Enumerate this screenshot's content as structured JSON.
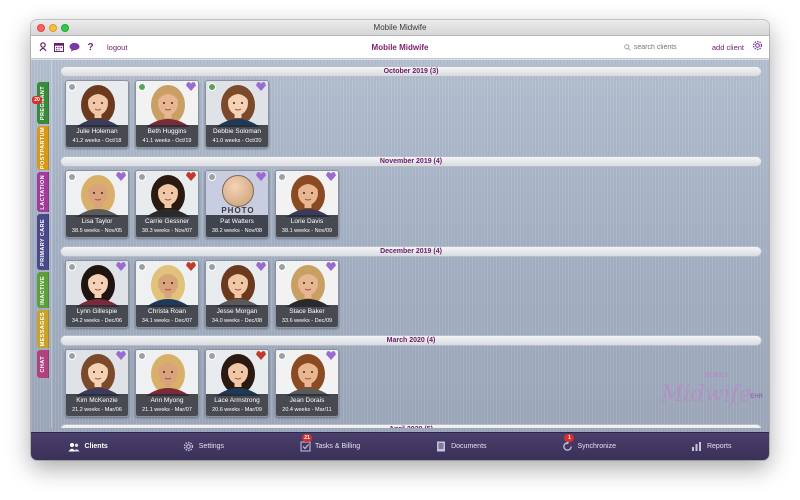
{
  "window": {
    "title": "Mobile Midwife"
  },
  "toolbar": {
    "logout_label": "logout",
    "app_title": "Mobile Midwife",
    "search_placeholder": "search clients",
    "add_client_label": "add client"
  },
  "side_tabs": [
    {
      "label": "Pregnant",
      "color": "#3a8a3c",
      "badge": "20"
    },
    {
      "label": "Postpartum",
      "color": "#d69a1a"
    },
    {
      "label": "Lactation",
      "color": "#a13c9a"
    },
    {
      "label": "Primary Care",
      "color": "#4a4a8a"
    },
    {
      "label": "Inactive",
      "color": "#5e9e3c"
    },
    {
      "label": "Messages",
      "color": "#c9a22a"
    },
    {
      "label": "Chat",
      "color": "#b0427f"
    }
  ],
  "groups": [
    {
      "title": "October 2019 (3)",
      "clients": [
        {
          "name": "Julie Holeman",
          "weeks": "41.2 weeks - Oct/18",
          "badge": "none"
        },
        {
          "name": "Beth Huggins",
          "weeks": "41.1 weeks - Oct/19",
          "badge": "purple"
        },
        {
          "name": "Debbie Soloman",
          "weeks": "41.0 weeks - Oct/20",
          "badge": "purple"
        }
      ]
    },
    {
      "title": "November 2019 (4)",
      "clients": [
        {
          "name": "Lisa Taylor",
          "weeks": "38.5 weeks - Nov/05",
          "badge": "purple"
        },
        {
          "name": "Carrie Gessner",
          "weeks": "38.3 weeks - Nov/07",
          "badge": "red"
        },
        {
          "name": "Pat Watters",
          "weeks": "38.2 weeks - Nov/08",
          "badge": "purple",
          "placeholder": "PHOTO"
        },
        {
          "name": "Lorie Davis",
          "weeks": "38.1 weeks - Nov/09",
          "badge": "purple"
        }
      ]
    },
    {
      "title": "December 2019 (4)",
      "clients": [
        {
          "name": "Lynn Gillespie",
          "weeks": "34.2 weeks - Dec/06",
          "badge": "purple"
        },
        {
          "name": "Christa Roan",
          "weeks": "34.1 weeks - Dec/07",
          "badge": "red"
        },
        {
          "name": "Jesse Morgan",
          "weeks": "34.0 weeks - Dec/08",
          "badge": "purple"
        },
        {
          "name": "Stace Baker",
          "weeks": "33.6 weeks - Dec/09",
          "badge": "purple"
        }
      ]
    },
    {
      "title": "March 2020 (4)",
      "clients": [
        {
          "name": "Kim McKenzie",
          "weeks": "21.2 weeks - Mar/06",
          "badge": "purple"
        },
        {
          "name": "Ann Myong",
          "weeks": "21.1 weeks - Mar/07",
          "badge": "none"
        },
        {
          "name": "Lace Armstrong",
          "weeks": "20.6 weeks - Mar/09",
          "badge": "red"
        },
        {
          "name": "Jean Dorais",
          "weeks": "20.4 weeks - Mar/11",
          "badge": "purple"
        }
      ]
    },
    {
      "title": "April 2020 (5)",
      "clients": []
    }
  ],
  "logo": {
    "small": "MOBILE",
    "big": "Midwife",
    "ehr": "EHR"
  },
  "bottom_nav": [
    {
      "label": "Clients",
      "icon": "clients-icon",
      "active": true
    },
    {
      "label": "Settings",
      "icon": "gear-icon"
    },
    {
      "label": "Tasks & Billing",
      "icon": "tasks-icon",
      "badge": "21"
    },
    {
      "label": "Documents",
      "icon": "documents-icon"
    },
    {
      "label": "Synchronize",
      "icon": "sync-icon",
      "badge": "1"
    },
    {
      "label": "Reports",
      "icon": "reports-icon"
    }
  ]
}
